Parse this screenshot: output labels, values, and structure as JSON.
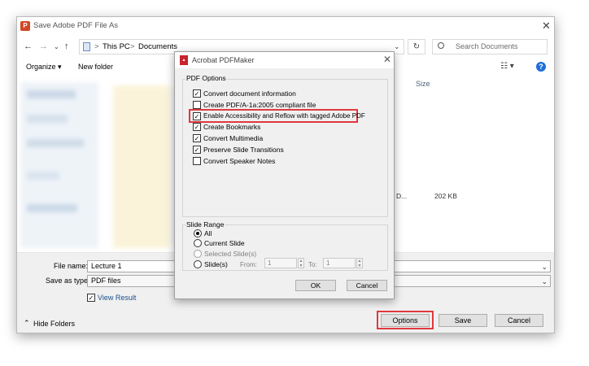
{
  "save_dialog": {
    "title": "Save Adobe PDF File As",
    "breadcrumb": [
      "This PC",
      "Documents"
    ],
    "breadcrumb_sep": ">",
    "search_placeholder": "Search Documents",
    "toolbar": {
      "organize": "Organize ▾",
      "new_folder": "New folder"
    },
    "column_size_header": "Size",
    "file_row": {
      "name_fragment": "D...",
      "size": "202 KB"
    },
    "file_name_label": "File name:",
    "file_name_value": "Lecture 1",
    "save_as_type_label": "Save as type:",
    "save_as_type_value": "PDF files",
    "view_result_label": "View Result",
    "hide_folders_label": "Hide Folders",
    "buttons": {
      "options": "Options",
      "save": "Save",
      "cancel": "Cancel"
    }
  },
  "pdfmaker_dialog": {
    "title": "Acrobat PDFMaker",
    "pdf_options_title": "PDF Options",
    "options": [
      {
        "label": "Convert document information",
        "checked": true
      },
      {
        "label": "Create PDF/A-1a:2005 compliant file",
        "checked": false
      },
      {
        "label": "Enable Accessibility and Reflow with tagged Adobe PDF",
        "checked": true,
        "highlighted": true
      },
      {
        "label": "Create Bookmarks",
        "checked": true
      },
      {
        "label": "Convert Multimedia",
        "checked": true
      },
      {
        "label": "Preserve Slide Transitions",
        "checked": true
      },
      {
        "label": "Convert Speaker Notes",
        "checked": false
      }
    ],
    "slide_range_title": "Slide Range",
    "slide_range": {
      "all": "All",
      "current_slide": "Current Slide",
      "selected_slides": "Selected Slide(s)",
      "slides": "Slide(s)",
      "from_label": "From:",
      "from_value": "1",
      "to_label": "To:",
      "to_value": "1",
      "selected": "all"
    },
    "buttons": {
      "ok": "OK",
      "cancel": "Cancel"
    }
  },
  "colors": {
    "highlight_red": "#e0393e",
    "link_blue": "#1a4f8b",
    "dialog_bg": "#f0f0f0"
  }
}
